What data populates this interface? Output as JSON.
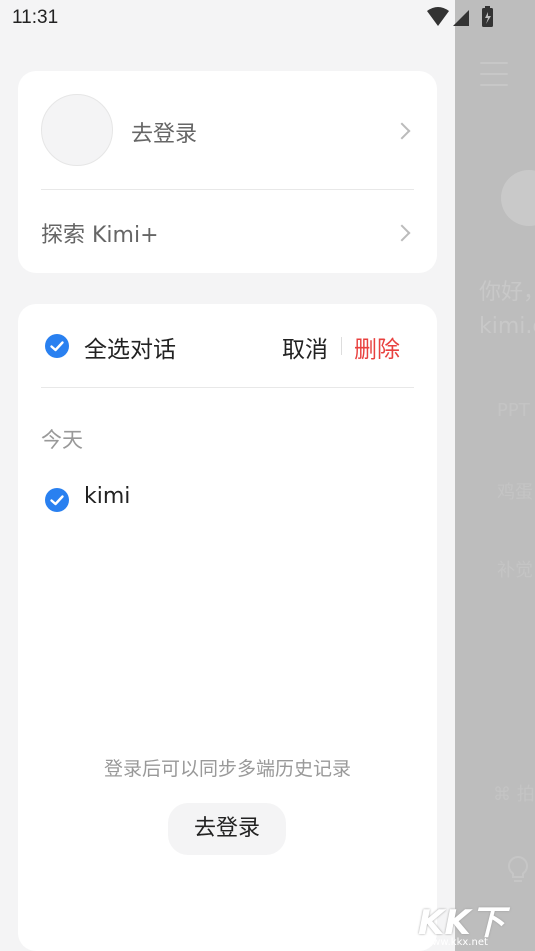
{
  "status_bar": {
    "time": "11:31"
  },
  "profile_card": {
    "login_label": "去登录",
    "explore_label": "探索 Kimi+"
  },
  "history": {
    "select_all_label": "全选对话",
    "cancel_label": "取消",
    "delete_label": "删除",
    "section_today": "今天",
    "items": [
      {
        "title": "kimi",
        "selected": true
      }
    ],
    "sync_hint": "登录后可以同步多端历史记录",
    "login_button": "去登录"
  },
  "background_chat": {
    "greeting": "你好，",
    "subtitle": "kimi.c",
    "suggestions": [
      "PPT",
      "鸡蛋",
      "补觉"
    ],
    "bottom_hint": "拍"
  },
  "watermark": {
    "text": "KK下载",
    "url": "www.kkx.net"
  },
  "colors": {
    "accent": "#2980f0",
    "danger": "#e8413f",
    "dim": "#bdbdbd"
  }
}
